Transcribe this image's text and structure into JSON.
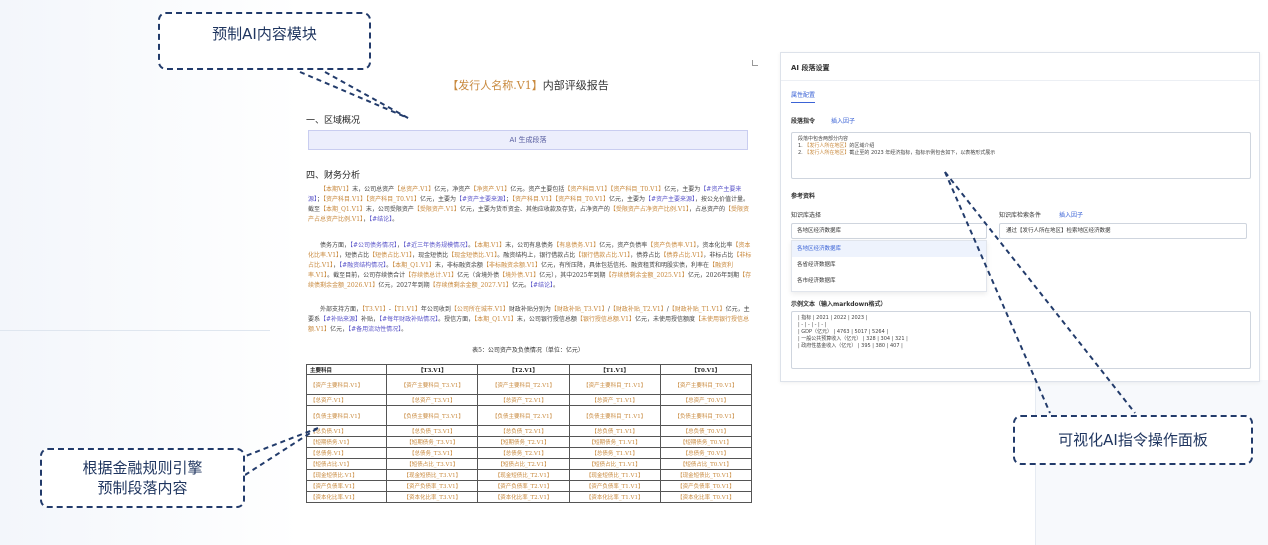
{
  "document": {
    "title_placeholder": "【发行人名称.V1】",
    "title_suffix": "内部评级报告",
    "section1": "一、区域概况",
    "ai_block": "AI 生成段落",
    "section4": "四、财务分析",
    "para1": "【本期V1】末，公司总资产【总资产.V1】亿元，净资产【净资产.V1】亿元。资产主要包括【资产科目.V1】【资产科目_T0.V1】亿元，主要为【#资产主要来源】；【资产科目.V1】【资产科目_T0.V1】亿元，主要为【#资产主要来源】；【资产科目.V1】【资产科目_T0.V1】亿元，主要为【#资产主要来源】，按公允价值计量。截至【本期_Q1.V1】末，公司受限资产【受限资产.V1】亿元，主要为货币资金、其他应收款及存货，占净资产的【受限资产占净资产比例.V1】，占总资产的【受限资产占总资产比例.V1】，【#结论】。",
    "para2": "债务方面，【#公司债务情况】，【#近三年债务规模情况】。【本期.V1】末，公司有息债务【有息债务.V1】亿元，资产负债率【资产负债率.V1】，资本化比率【资本化比率.V1】，短债占比【短债占比.V1】，现金短债比【现金短债比.V1】。融资结构上，银行借款占比【银行借款占比.V1】，债券占比【债券占比.V1】，非标占比【非标占比.V1】，【#融资结构情况】。【本期_Q1.V1】末，非标融资余额【非标融资余额.V1】亿元，有所压降，具体包括信托、融资租赁和明股实债，利率在【融资利率.V1】。截至目前，公司存续债合计【存续债总计.V1】亿元（含境外债【境外债.V1】亿元），其中2025年到期【存续债剩余金额_2025.V1】亿元，2026年到期【存续债剩余金额_2026.V1】亿元，2027年到期【存续债剩余金额_2027.V1】亿元。【#结论】。",
    "para3": "外部支持方面，【T3.V1】-【T1.V1】年公司收到【公司所在城市.V1】财政补贴分别为【财政补贴_T3.V1】/【财政补贴_T2.V1】/【财政补贴_T1.V1】亿元，主要系【#补贴来源】补贴，【#每年财政补贴情况】。授信方面，【本期_Q1.V1】末，公司银行授信总额【银行授信总额.V1】亿元，未使用授信额度【未使用银行授信总额.V1】亿元，【#备用流动性情况】。",
    "table_caption": "表5：公司资产及负债情况（单位：亿元）",
    "table": {
      "headers": [
        "主要科目",
        "【T3.V1】",
        "【T2.V1】",
        "【T1.V1】",
        "【T0.V1】"
      ],
      "rows": [
        [
          "【资产主要科目.V1】",
          "【资产主要科目_T3.V1】",
          "【资产主要科目_T2.V1】",
          "【资产主要科目_T1.V1】",
          "【资产主要科目_T0.V1】"
        ],
        [
          "【总资产.V1】",
          "【总资产_T3.V1】",
          "【总资产_T2.V1】",
          "【总资产_T1.V1】",
          "【总资产_T0.V1】"
        ],
        [
          "【负债主要科目.V1】",
          "【负债主要科目_T3.V1】",
          "【负债主要科目_T2.V1】",
          "【负债主要科目_T1.V1】",
          "【负债主要科目_T0.V1】"
        ],
        [
          "【总负债.V1】",
          "【总负债_T3.V1】",
          "【总负债_T2.V1】",
          "【总负债_T1.V1】",
          "【总负债_T0.V1】"
        ],
        [
          "【短期债务.V1】",
          "【短期债务_T3.V1】",
          "【短期债务_T2.V1】",
          "【短期债务_T1.V1】",
          "【短期债务_T0.V1】"
        ],
        [
          "【总债务.V1】",
          "【总债务_T3.V1】",
          "【总债务_T2.V1】",
          "【总债务_T1.V1】",
          "【总债务_T0.V1】"
        ],
        [
          "【短债占比.V1】",
          "【短债占比_T3.V1】",
          "【短债占比_T2.V1】",
          "【短债占比_T1.V1】",
          "【短债占比_T0.V1】"
        ],
        [
          "【现金短债比.V1】",
          "【现金短债比_T3.V1】",
          "【现金短债比_T2.V1】",
          "【现金短债比_T1.V1】",
          "【现金短债比_T0.V1】"
        ],
        [
          "【资产负债率.V1】",
          "【资产负债率_T3.V1】",
          "【资产负债率_T2.V1】",
          "【资产负债率_T1.V1】",
          "【资产负债率_T0.V1】"
        ],
        [
          "【资本化比率.V1】",
          "【资本化比率_T3.V1】",
          "【资本化比率_T2.V1】",
          "【资本化比率_T1.V1】",
          "【资本化比率_T0.V1】"
        ]
      ]
    }
  },
  "panel": {
    "title": "AI 段落设置",
    "tab": "属性配置",
    "instruction_label": "段落指令",
    "insert_factor": "插入因子",
    "instruction_line1": "段落中包含两部分内容",
    "instruction_line2_pre": "1.",
    "instruction_line2_ph": "【发行人所在地区】",
    "instruction_line2_post": "的区域介绍",
    "instruction_line3_pre": "2.",
    "instruction_line3_ph": "【发行人所在地区】",
    "instruction_line3_post": "截止至的 2023 年经济指标，指标示例包含如下，以表格形式展示",
    "reference_label": "参考资料",
    "kb_label": "知识库选择",
    "kb_selected": "各地区经济数据库",
    "kb_options": [
      "各地区经济数据库",
      "各省经济数据库",
      "各市经济数据库"
    ],
    "cond_label": "知识库检索条件",
    "cond_insert": "插入因子",
    "cond_value": "通过【发行人所在地区】检索地区经济数据",
    "example_label": "示例文本（输入markdown格式）",
    "example_lines": [
      "| 指标 | 2021 | 2022 | 2023 |",
      "| - | - | - | - |",
      "| GDP（亿元） | 4763 | 5017 | 5264 |",
      "| 一般公共预算收入（亿元） | 328 | 304 | 321 |",
      "| 政府性基金收入（亿元） | 395 | 380 | 407 |"
    ]
  },
  "callouts": {
    "top": "预制AI内容模块",
    "bottom_line1": "根据金融规则引擎",
    "bottom_line2": "预制段落内容",
    "right": "可视化AI指令操作面板"
  }
}
